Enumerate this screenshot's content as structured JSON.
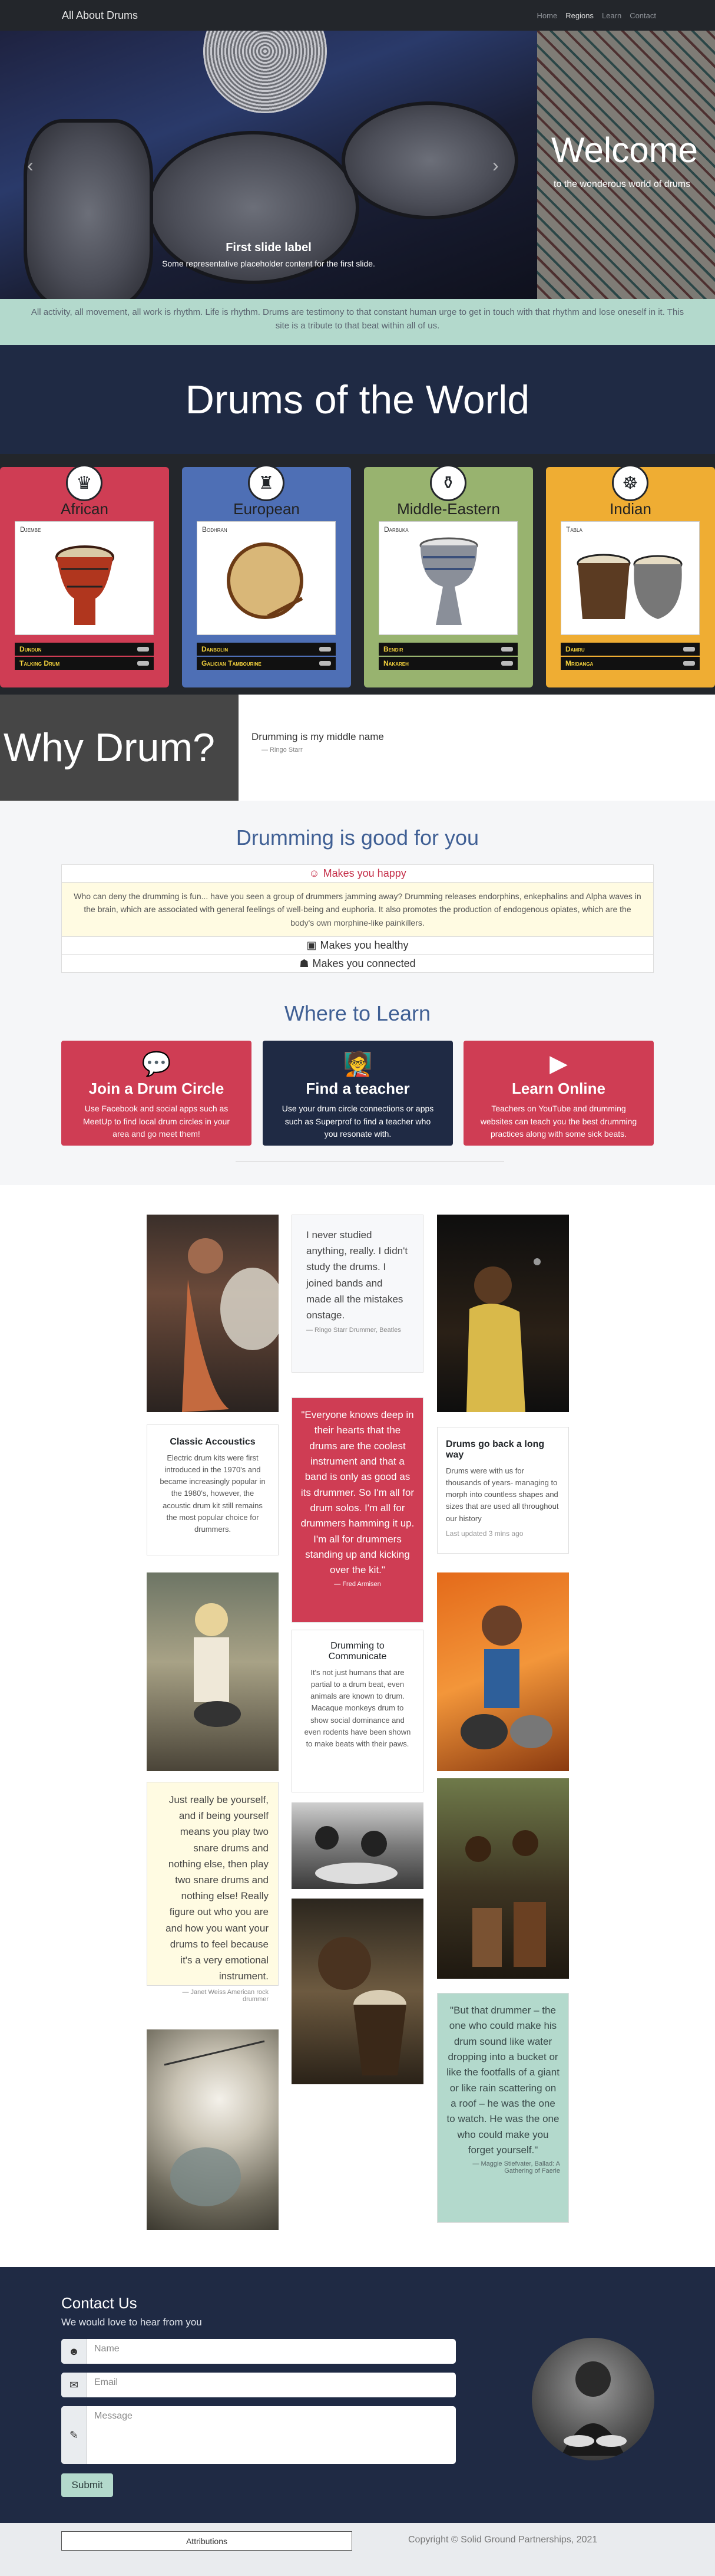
{
  "nav": {
    "brand": "All About Drums",
    "links": [
      "Home",
      "Regions",
      "Learn",
      "Contact"
    ],
    "active": 1
  },
  "carousel": {
    "caption_title": "First slide label",
    "caption_text": "Some representative placeholder content for the first slide.",
    "prev": "‹",
    "next": "›"
  },
  "welcome": {
    "title": "Welcome",
    "subtitle": "to the wonderous world of drums"
  },
  "intro": "All activity, all movement, all work is rhythm. Life is rhythm. Drums are testimony to that constant human urge to get in touch with that rhythm and lose oneself in it. This site is a tribute to that beat within all of us.",
  "band_title": "Drums of the World",
  "regions": [
    {
      "name": "African",
      "drum": "Djembe",
      "rows": [
        "Dundun",
        "Talking Drum"
      ],
      "color": "#cf3d54",
      "icon": "african-mask-icon",
      "glyph": "♛"
    },
    {
      "name": "European",
      "drum": "Bodhran",
      "rows": [
        "Danbolin",
        "Galician Tambourine"
      ],
      "color": "#4e6fb5",
      "icon": "castle-icon",
      "glyph": "♜"
    },
    {
      "name": "Middle-Eastern",
      "drum": "Darbuka",
      "rows": [
        "Bendir",
        "Nakareh"
      ],
      "color": "#98b36f",
      "icon": "lamp-icon",
      "glyph": "⚱"
    },
    {
      "name": "Indian",
      "drum": "Tabla",
      "rows": [
        "Damru",
        "Mridanga"
      ],
      "color": "#efad33",
      "icon": "elephant-icon",
      "glyph": "☸"
    }
  ],
  "why": {
    "title": "Why Drum?",
    "quote": "Drumming is my middle name",
    "source": "— Ringo Starr"
  },
  "good": {
    "title": "Drumming is good for you",
    "items": [
      {
        "label": "Makes you happy",
        "icon": "smile-icon",
        "glyph": "☺",
        "body": "Who can deny the drumming is fun... have you seen a group of drummers jamming away? Drumming releases endorphins, enkephalins and Alpha waves in the brain, which are associated with general feelings of well-being and euphoria. It also promotes the production of endogenous opiates, which are the body's own morphine-like painkillers."
      },
      {
        "label": "Makes you healthy",
        "icon": "health-icon",
        "glyph": "▣"
      },
      {
        "label": "Makes you connected",
        "icon": "people-icon",
        "glyph": "☗"
      }
    ]
  },
  "learn": {
    "title": "Where to Learn",
    "cards": [
      {
        "title": "Join a Drum Circle",
        "text": "Use Facebook and social apps such as MeetUp to find local drum circles in your area and go meet them!",
        "icon": "comments-icon",
        "glyph": "💬",
        "color": "#cf3d54"
      },
      {
        "title": "Find a teacher",
        "text": "Use your drum circle connections or apps such as Superprof to find a teacher who you resonate with.",
        "icon": "teacher-icon",
        "glyph": "🧑‍🏫",
        "color": "#1f2a44"
      },
      {
        "title": "Learn Online",
        "text": "Teachers on YouTube and drumming websites can teach you the best drumming practices along with some sick beats.",
        "icon": "youtube-icon",
        "glyph": "▶",
        "color": "#cf3d54"
      }
    ]
  },
  "masonry": {
    "q1": {
      "text": "I never studied anything, really. I didn't study the drums. I joined bands and made all the mistakes onstage.",
      "cite": "— Ringo Starr Drummer, Beatles"
    },
    "classic": {
      "title": "Classic Accoustics",
      "text": "Electric drum kits were first introduced in the 1970's and became increasingly popular in the 1980's, however, the acoustic drum kit still remains the most popular choice for drummers."
    },
    "q2": {
      "text": "\"Everyone knows deep in their hearts that the drums are the coolest instrument and that a band is only as good as its drummer. So I'm all for drum solos. I'm all for drummers hamming it up. I'm all for drummers standing up and kicking over the kit.\"",
      "cite": "— Fred Armisen"
    },
    "way": {
      "title": "Drums go back a long way",
      "text": "Drums were with us for thousands of years- managing to morph into countless shapes and sizes that are used all throughout our history",
      "updated": "Last updated 3 mins ago"
    },
    "comm": {
      "title": "Drumming to Communicate",
      "text": "It's not just humans that are partial to a drum beat, even animals are known to drum. Macaque monkeys drum to show social dominance and even rodents have been shown to make beats with their paws."
    },
    "q3": {
      "text": "Just really be yourself, and if being yourself means you play two snare drums and nothing else, then play two snare drums and nothing else! Really figure out who you are and how you want your drums to feel because it's a very emotional instrument.",
      "cite": "— Janet Weiss American rock drummer"
    },
    "q4": {
      "text": "\"But that drummer – the one who could make his drum sound like water dropping into a bucket or like the footfalls of a giant or like rain scattering on a roof – he was the one to watch. He was the one who could make you forget yourself.\"",
      "cite": "— Maggie Stiefvater, Ballad: A Gathering of Faerie"
    }
  },
  "contact": {
    "title": "Contact Us",
    "subtitle": "We would love to hear from you",
    "name_ph": "Name",
    "email_ph": "Email",
    "msg_ph": "Message",
    "submit": "Submit"
  },
  "footer": {
    "attributions": "Attributions",
    "copyright": "Copyright © Solid Ground Partnerships, 2021"
  }
}
